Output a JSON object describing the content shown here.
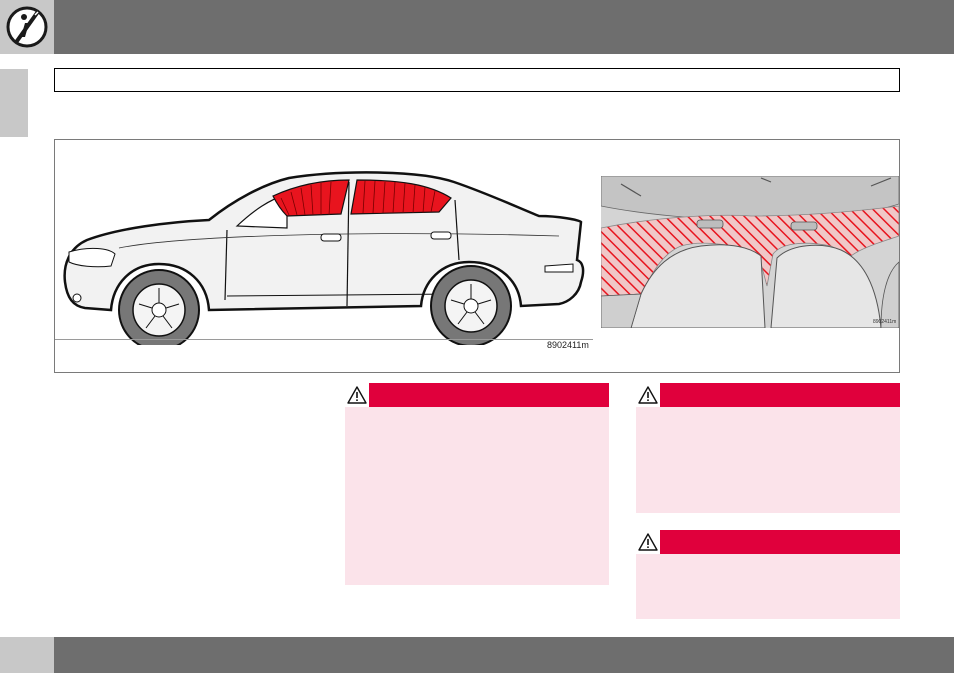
{
  "figure": {
    "code": "8902411m",
    "inset_code": "8902411m"
  },
  "icons": {
    "info": "info-pen-icon",
    "warning": "warning-triangle-icon"
  },
  "colors": {
    "header_bar": "#6e6e6e",
    "tab_gray": "#c8c8c8",
    "warning_red": "#e0003c",
    "warning_bg": "#fbe3ea",
    "airbag_red": "#e8141e"
  },
  "warnings": [
    {
      "id": "warning-1"
    },
    {
      "id": "warning-2"
    },
    {
      "id": "warning-3"
    }
  ]
}
